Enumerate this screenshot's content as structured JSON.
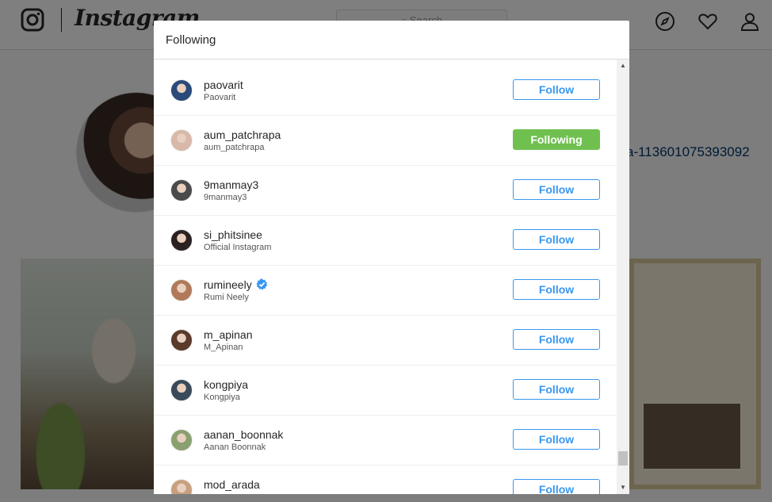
{
  "app": {
    "wordmark": "Instagram",
    "search_placeholder": "Search",
    "profile_link_fragment": "a-113601075393092"
  },
  "modal": {
    "title": "Following",
    "rows": [
      {
        "username": "paovarit",
        "fullname": "Paovarit",
        "button": "Follow",
        "state": "follow",
        "verified": false,
        "avatar_color": "#2a4a7a"
      },
      {
        "username": "aum_patchrapa",
        "fullname": "aum_patchrapa",
        "button": "Following",
        "state": "following",
        "verified": false,
        "avatar_color": "#d8b8a8"
      },
      {
        "username": "9manmay3",
        "fullname": "9manmay3",
        "button": "Follow",
        "state": "follow",
        "verified": false,
        "avatar_color": "#4a4a4a"
      },
      {
        "username": "si_phitsinee",
        "fullname": "Official Instagram",
        "button": "Follow",
        "state": "follow",
        "verified": false,
        "avatar_color": "#2a2220"
      },
      {
        "username": "rumineely",
        "fullname": "Rumi Neely",
        "button": "Follow",
        "state": "follow",
        "verified": true,
        "avatar_color": "#b07a5a"
      },
      {
        "username": "m_apinan",
        "fullname": "M_Apinan",
        "button": "Follow",
        "state": "follow",
        "verified": false,
        "avatar_color": "#5a3a2a"
      },
      {
        "username": "kongpiya",
        "fullname": "Kongpiya",
        "button": "Follow",
        "state": "follow",
        "verified": false,
        "avatar_color": "#3a4a5a"
      },
      {
        "username": "aanan_boonnak",
        "fullname": "Aanan Boonnak",
        "button": "Follow",
        "state": "follow",
        "verified": false,
        "avatar_color": "#8aa070"
      },
      {
        "username": "mod_arada",
        "fullname": "",
        "button": "Follow",
        "state": "follow",
        "verified": false,
        "avatar_color": "#c8a080"
      }
    ]
  },
  "colors": {
    "follow_blue": "#3897f0",
    "following_green": "#70c050",
    "verified_blue": "#3897f0"
  },
  "icons": [
    "instagram-logo-icon",
    "explore-compass-icon",
    "heart-icon",
    "profile-icon",
    "verified-badge-icon",
    "scroll-up-arrow-icon",
    "scroll-down-arrow-icon"
  ]
}
